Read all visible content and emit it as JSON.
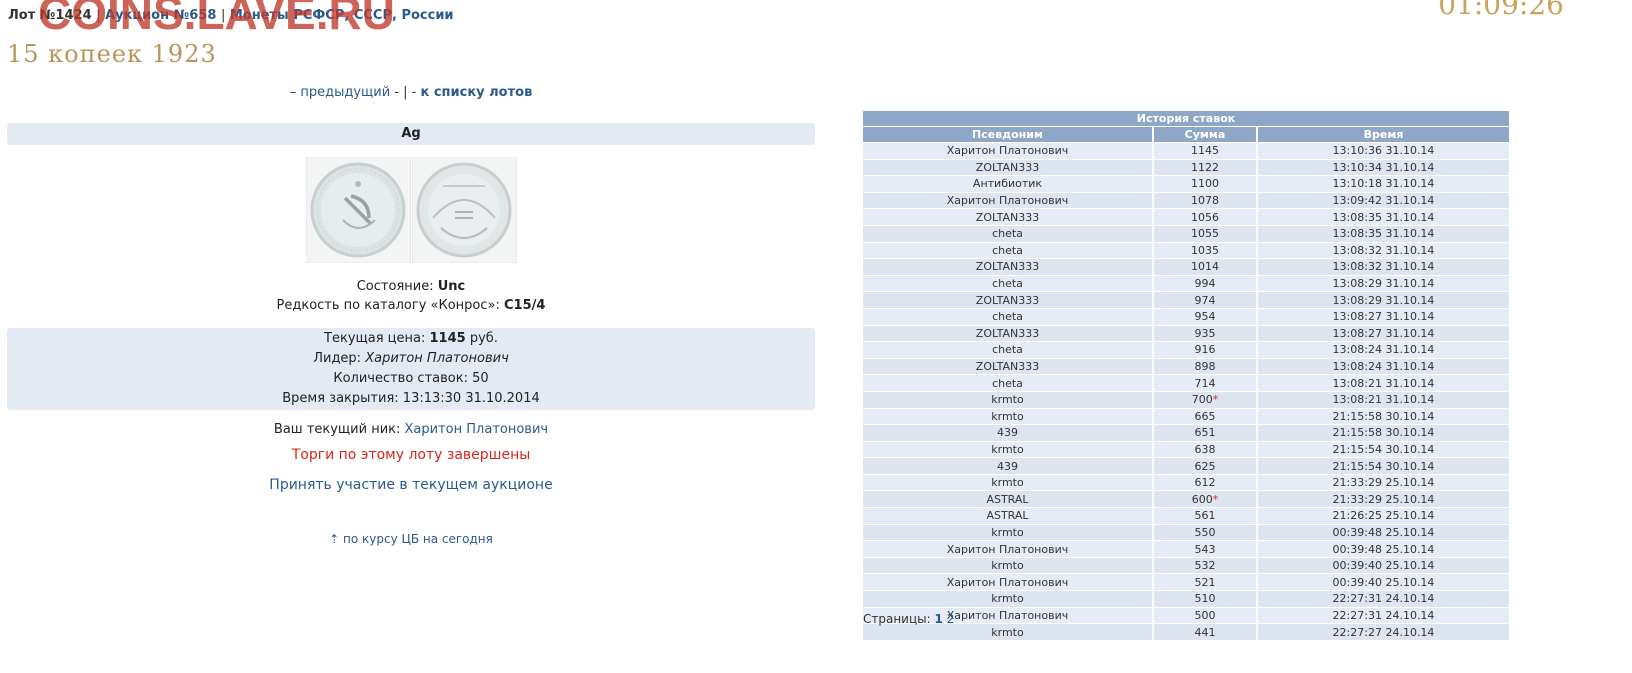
{
  "breadcrumb": {
    "lot": "Лот №1424",
    "sep1": "|",
    "auction": "Аукцион №658",
    "sep2": "|",
    "category": "Монеты РСФСР, СССР, России"
  },
  "watermark": "COINS.LAVE.RU",
  "clock": "01:09:26",
  "lot_title": "15 копеек 1923",
  "nav": {
    "prefix": "–",
    "prev": "предыдущий",
    "sep": "- | -",
    "list": "к списку лотов"
  },
  "metal": "Ag",
  "condition": {
    "label": "Состояние:",
    "value": "Unc"
  },
  "rarity": {
    "label": "Редкость по каталогу «Конрос»:",
    "value": "C15/4"
  },
  "price_box": {
    "price_label": "Текущая цена:",
    "price_value": "1145",
    "price_unit": "руб.",
    "leader_label": "Лидер:",
    "leader_value": "Харитон Платонович",
    "bids_label": "Количество ставок:",
    "bids_value": "50",
    "close_label": "Время закрытия:",
    "close_value": "13:13:30 31.10.2014"
  },
  "nick": {
    "label": "Ваш текущий ник:",
    "value": "Харитон Платонович"
  },
  "closed_message": "Торги по этому лоту завершены",
  "join_link": "Принять участие в текущем аукционе",
  "rate_link": "по курсу ЦБ на сегодня",
  "bid_history": {
    "caption": "История ставок",
    "headers": [
      "Псевдоним",
      "Сумма",
      "Время"
    ],
    "rows": [
      {
        "nick": "Харитон Платонович",
        "sum": "1145",
        "star": "",
        "time": "13:10:36 31.10.14"
      },
      {
        "nick": "ZOLTAN333",
        "sum": "1122",
        "star": "",
        "time": "13:10:34 31.10.14"
      },
      {
        "nick": "Антибиотик",
        "sum": "1100",
        "star": "",
        "time": "13:10:18 31.10.14"
      },
      {
        "nick": "Харитон Платонович",
        "sum": "1078",
        "star": "",
        "time": "13:09:42 31.10.14"
      },
      {
        "nick": "ZOLTAN333",
        "sum": "1056",
        "star": "",
        "time": "13:08:35 31.10.14"
      },
      {
        "nick": "cheta",
        "sum": "1055",
        "star": "",
        "time": "13:08:35 31.10.14"
      },
      {
        "nick": "cheta",
        "sum": "1035",
        "star": "",
        "time": "13:08:32 31.10.14"
      },
      {
        "nick": "ZOLTAN333",
        "sum": "1014",
        "star": "",
        "time": "13:08:32 31.10.14"
      },
      {
        "nick": "cheta",
        "sum": "994",
        "star": "",
        "time": "13:08:29 31.10.14"
      },
      {
        "nick": "ZOLTAN333",
        "sum": "974",
        "star": "",
        "time": "13:08:29 31.10.14"
      },
      {
        "nick": "cheta",
        "sum": "954",
        "star": "",
        "time": "13:08:27 31.10.14"
      },
      {
        "nick": "ZOLTAN333",
        "sum": "935",
        "star": "",
        "time": "13:08:27 31.10.14"
      },
      {
        "nick": "cheta",
        "sum": "916",
        "star": "",
        "time": "13:08:24 31.10.14"
      },
      {
        "nick": "ZOLTAN333",
        "sum": "898",
        "star": "",
        "time": "13:08:24 31.10.14"
      },
      {
        "nick": "cheta",
        "sum": "714",
        "star": "",
        "time": "13:08:21 31.10.14"
      },
      {
        "nick": "krmto",
        "sum": "700",
        "star": "*",
        "time": "13:08:21 31.10.14"
      },
      {
        "nick": "krmto",
        "sum": "665",
        "star": "",
        "time": "21:15:58 30.10.14"
      },
      {
        "nick": "439",
        "sum": "651",
        "star": "",
        "time": "21:15:58 30.10.14"
      },
      {
        "nick": "krmto",
        "sum": "638",
        "star": "",
        "time": "21:15:54 30.10.14"
      },
      {
        "nick": "439",
        "sum": "625",
        "star": "",
        "time": "21:15:54 30.10.14"
      },
      {
        "nick": "krmto",
        "sum": "612",
        "star": "",
        "time": "21:33:29 25.10.14"
      },
      {
        "nick": "ASTRAL",
        "sum": "600",
        "star": "*",
        "time": "21:33:29 25.10.14"
      },
      {
        "nick": "ASTRAL",
        "sum": "561",
        "star": "",
        "time": "21:26:25 25.10.14"
      },
      {
        "nick": "krmto",
        "sum": "550",
        "star": "",
        "time": "00:39:48 25.10.14"
      },
      {
        "nick": "Харитон Платонович",
        "sum": "543",
        "star": "",
        "time": "00:39:48 25.10.14"
      },
      {
        "nick": "krmto",
        "sum": "532",
        "star": "",
        "time": "00:39:40 25.10.14"
      },
      {
        "nick": "Харитон Платонович",
        "sum": "521",
        "star": "",
        "time": "00:39:40 25.10.14"
      },
      {
        "nick": "krmto",
        "sum": "510",
        "star": "",
        "time": "22:27:31 24.10.14"
      },
      {
        "nick": "Харитон Платонович",
        "sum": "500",
        "star": "",
        "time": "22:27:31 24.10.14"
      },
      {
        "nick": "krmto",
        "sum": "441",
        "star": "",
        "time": "22:27:27 24.10.14"
      }
    ]
  },
  "pagination": {
    "label": "Страницы:",
    "pages": [
      "1",
      "2"
    ],
    "current": "1"
  },
  "colors": {
    "link": "#2a5a8c",
    "header_bg": "#8ea7c6",
    "alert": "#d9261c",
    "title_gold": "#b8955a"
  }
}
